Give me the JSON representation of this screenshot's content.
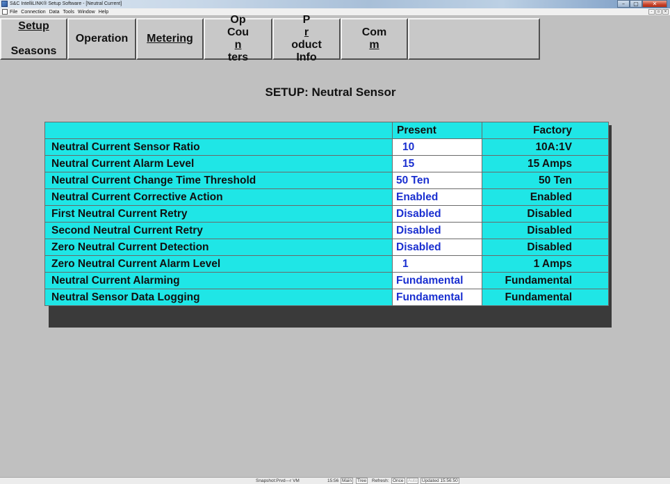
{
  "window": {
    "title": "S&C IntelliLINK® Setup Software - [Neutral Current]",
    "controls": {
      "minimize": "–",
      "maximize": "▢",
      "close": "✕"
    }
  },
  "menu": {
    "items": [
      "File",
      "Connection",
      "Data",
      "Tools",
      "Window",
      "Help"
    ],
    "mdi_controls": {
      "minimize": "-",
      "restore": "▫",
      "close": "×"
    }
  },
  "toolbar": {
    "buttons": [
      {
        "label": "Setup\nSeasons",
        "underline": "Setup"
      },
      {
        "label": "Operation"
      },
      {
        "label": "Metering",
        "underline": "Metering"
      },
      {
        "label": "Op\nCounters"
      },
      {
        "label": "Product\nInfo"
      },
      {
        "label": "Comm"
      },
      {
        "label": ""
      }
    ]
  },
  "page": {
    "title": "SETUP: Neutral Sensor"
  },
  "table": {
    "headers": {
      "setting": "",
      "present": "Present",
      "factory": "Factory"
    },
    "rows": [
      {
        "label": "Neutral Current Sensor Ratio",
        "present": "10",
        "factory": "10A:1V"
      },
      {
        "label": "Neutral Current Alarm Level",
        "present": "15",
        "factory": "15 Amps"
      },
      {
        "label": "Neutral Current Change Time Threshold",
        "present": "50 Ten",
        "factory": "50 Ten"
      },
      {
        "label": "Neutral Current Corrective Action",
        "present": "Enabled",
        "factory": "Enabled"
      },
      {
        "label": "First Neutral Current Retry",
        "present": "Disabled",
        "factory": "Disabled"
      },
      {
        "label": "Second Neutral Current Retry",
        "present": "Disabled",
        "factory": "Disabled"
      },
      {
        "label": "Zero Neutral Current Detection",
        "present": "Disabled",
        "factory": "Disabled"
      },
      {
        "label": "Zero Neutral Current Alarm Level",
        "present": "1",
        "factory": "1 Amps"
      },
      {
        "label": "Neutral Current Alarming",
        "present": "Fundamental",
        "factory": "Fundamental"
      },
      {
        "label": "Neutral Sensor Data Logging",
        "present": "Fundamental",
        "factory": "Fundamental"
      }
    ]
  },
  "statusbar": {
    "snapshot": "Snapshot:Prvd---r VM",
    "time": "15:56",
    "main": "Main",
    "tree": "Tree",
    "refresh_label": "Refresh:",
    "once": "Once",
    "auto": "Auto",
    "updated": "Updated 15:56:50"
  }
}
